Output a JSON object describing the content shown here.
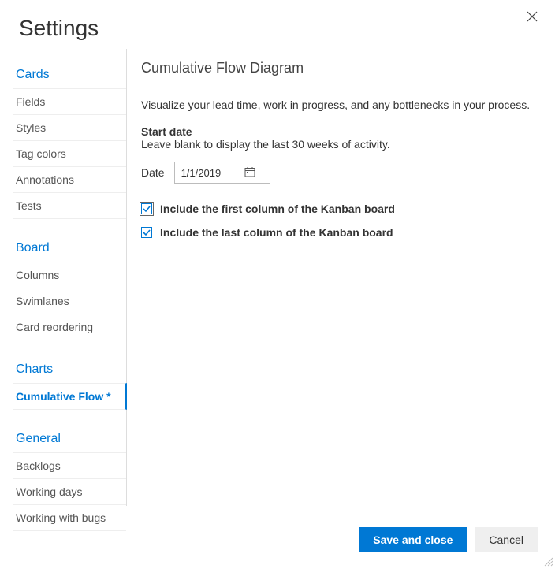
{
  "dialog": {
    "title": "Settings"
  },
  "sidebar": {
    "sections": [
      {
        "header": "Cards",
        "items": [
          {
            "label": "Fields",
            "active": false
          },
          {
            "label": "Styles",
            "active": false
          },
          {
            "label": "Tag colors",
            "active": false
          },
          {
            "label": "Annotations",
            "active": false
          },
          {
            "label": "Tests",
            "active": false
          }
        ]
      },
      {
        "header": "Board",
        "items": [
          {
            "label": "Columns",
            "active": false
          },
          {
            "label": "Swimlanes",
            "active": false
          },
          {
            "label": "Card reordering",
            "active": false
          }
        ]
      },
      {
        "header": "Charts",
        "items": [
          {
            "label": "Cumulative Flow *",
            "active": true
          }
        ]
      },
      {
        "header": "General",
        "items": [
          {
            "label": "Backlogs",
            "active": false
          },
          {
            "label": "Working days",
            "active": false
          },
          {
            "label": "Working with bugs",
            "active": false
          }
        ]
      }
    ]
  },
  "panel": {
    "title": "Cumulative Flow Diagram",
    "description": "Visualize your lead time, work in progress, and any bottlenecks in your process.",
    "start_date_label": "Start date",
    "start_date_hint": "Leave blank to display the last 30 weeks of activity.",
    "date_label": "Date",
    "date_value": "1/1/2019",
    "include_first_label": "Include the first column of the Kanban board",
    "include_first_checked": true,
    "include_last_label": "Include the last column of the Kanban board",
    "include_last_checked": true
  },
  "footer": {
    "save_label": "Save and close",
    "cancel_label": "Cancel"
  }
}
